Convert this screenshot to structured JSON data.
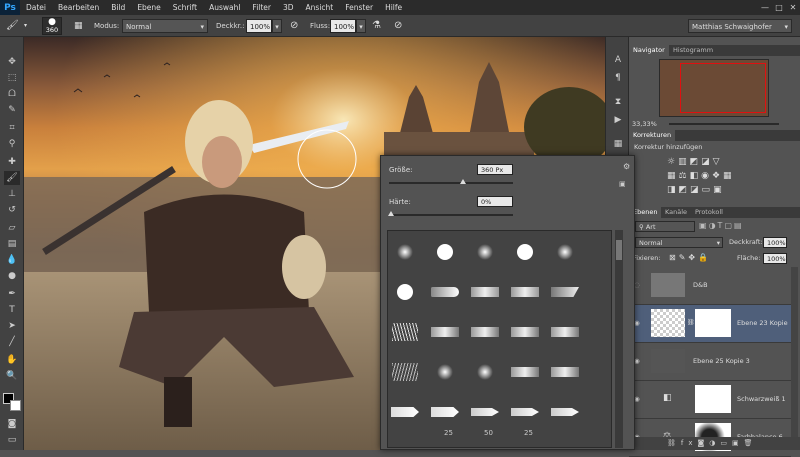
{
  "menubar": {
    "logo": "Ps",
    "items": [
      "Datei",
      "Bearbeiten",
      "Bild",
      "Ebene",
      "Schrift",
      "Auswahl",
      "Filter",
      "3D",
      "Ansicht",
      "Fenster",
      "Hilfe"
    ]
  },
  "options": {
    "brush_size": "360",
    "mode_label": "Modus:",
    "mode_value": "Normal",
    "opacity_label": "Deckkr.:",
    "opacity_value": "100%",
    "flow_label": "Fluss:",
    "flow_value": "100%",
    "workspace": "Matthias Schwaighofer"
  },
  "brush_picker": {
    "size_label": "Größe:",
    "size_value": "360 Px",
    "hardness_label": "Härte:",
    "hardness_value": "0%",
    "size_level": 0.6,
    "hardness_level": 0.0,
    "row5_labels": [
      "25",
      "50",
      "25"
    ]
  },
  "navigator": {
    "tab_navigator": "Navigator",
    "tab_histogram": "Histogramm",
    "zoom": "33,33%"
  },
  "adjustments": {
    "tab": "Korrekturen",
    "heading": "Korrektur hinzufügen"
  },
  "layers": {
    "tab_layers": "Ebenen",
    "tab_channels": "Kanäle",
    "tab_protocol": "Protokoll",
    "filter_kind": "Art",
    "blend_mode": "Normal",
    "opacity_label": "Deckkraft:",
    "opacity_value": "100%",
    "lock_label": "Fixieren:",
    "fill_label": "Fläche:",
    "fill_value": "100%",
    "rows": [
      {
        "name": "D&B"
      },
      {
        "name": "Ebene 23 Kopie"
      },
      {
        "name": "Ebene 25 Kopie 3"
      },
      {
        "name": "Schwarzweiß 1"
      },
      {
        "name": "Farbbalance 6"
      }
    ]
  }
}
